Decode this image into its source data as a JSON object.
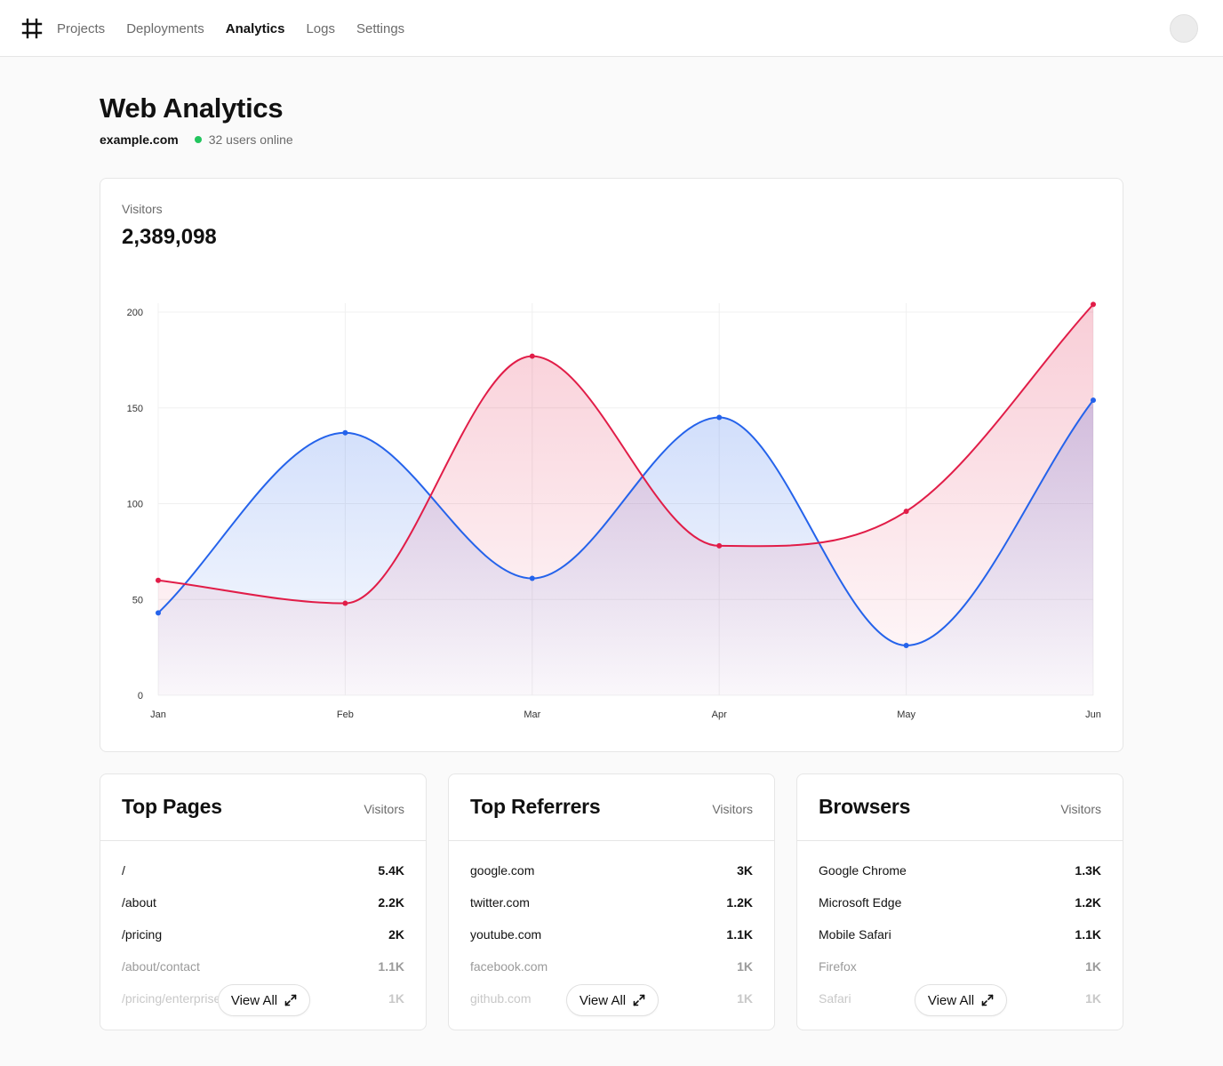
{
  "nav": {
    "logo_icon": "hash-logo-icon",
    "links": [
      "Projects",
      "Deployments",
      "Analytics",
      "Logs",
      "Settings"
    ],
    "active": "Analytics"
  },
  "header": {
    "title": "Web Analytics",
    "domain": "example.com",
    "online": "32 users online",
    "online_color": "#22c55e"
  },
  "chart_card": {
    "label": "Visitors",
    "total": "2,389,098"
  },
  "chart_data": {
    "type": "area",
    "categories": [
      "Jan",
      "Feb",
      "Mar",
      "Apr",
      "May",
      "Jun"
    ],
    "ylim": [
      0,
      200
    ],
    "yticks": [
      0,
      50,
      100,
      150,
      200
    ],
    "grid": true,
    "series": [
      {
        "values": [
          43,
          137,
          61,
          145,
          26,
          154
        ],
        "color": "#2563eb"
      },
      {
        "values": [
          60,
          48,
          177,
          78,
          96,
          204
        ],
        "color": "#e11d48"
      }
    ]
  },
  "cards": [
    {
      "title": "Top Pages",
      "column": "Visitors",
      "rows": [
        {
          "name": "/",
          "value": "5.4K"
        },
        {
          "name": "/about",
          "value": "2.2K"
        },
        {
          "name": "/pricing",
          "value": "2K"
        },
        {
          "name": "/about/contact",
          "value": "1.1K"
        },
        {
          "name": "/pricing/enterprise",
          "value": "1K"
        }
      ],
      "view_all": "View All"
    },
    {
      "title": "Top Referrers",
      "column": "Visitors",
      "rows": [
        {
          "name": "google.com",
          "value": "3K"
        },
        {
          "name": "twitter.com",
          "value": "1.2K"
        },
        {
          "name": "youtube.com",
          "value": "1.1K"
        },
        {
          "name": "facebook.com",
          "value": "1K"
        },
        {
          "name": "github.com",
          "value": "1K"
        }
      ],
      "view_all": "View All"
    },
    {
      "title": "Browsers",
      "column": "Visitors",
      "rows": [
        {
          "name": "Google Chrome",
          "value": "1.3K"
        },
        {
          "name": "Microsoft Edge",
          "value": "1.2K"
        },
        {
          "name": "Mobile Safari",
          "value": "1.1K"
        },
        {
          "name": "Firefox",
          "value": "1K"
        },
        {
          "name": "Safari",
          "value": "1K"
        }
      ],
      "view_all": "View All"
    }
  ]
}
